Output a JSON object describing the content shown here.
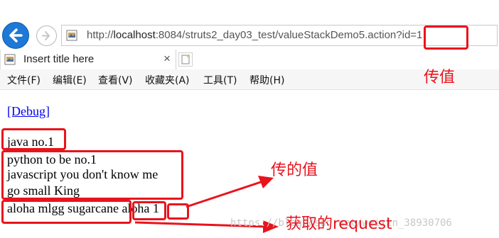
{
  "browser": {
    "url_prefix": "http://",
    "url_host": "localhost",
    "url_rest": ":8084/struts2_day03_test/valueStackDemo5.action?id=1",
    "tab_title": "Insert title here",
    "tab_close": "×"
  },
  "menu": [
    {
      "label": "文件(F)"
    },
    {
      "label": "编辑(E)"
    },
    {
      "label": "查看(V)"
    },
    {
      "label": "收藏夹(A)"
    },
    {
      "label": "工具(T)"
    },
    {
      "label": "帮助(H)"
    }
  ],
  "page": {
    "debug_link": "[Debug]",
    "line1": "java no.1",
    "line2": "python to be no.1",
    "line3": "javascript you don't know me",
    "line4": "go small King",
    "line5a": "aloha mlgg sugarcane",
    "line5b": "aloha",
    "line5c": "1"
  },
  "annotations": {
    "pass_value": "传值",
    "passed_value": "传的值",
    "obtained_request": "获取的request"
  },
  "watermark": "https://blog.csdn.net/weixin_38930706",
  "colors": {
    "annotation": "#e8131d",
    "back_button": "#1d78d6",
    "link": "#0000ee"
  },
  "icons": {
    "back": "back-arrow-icon",
    "forward": "forward-arrow-icon",
    "page": "page-icon",
    "close": "close-icon",
    "new_tab": "new-tab-icon"
  }
}
